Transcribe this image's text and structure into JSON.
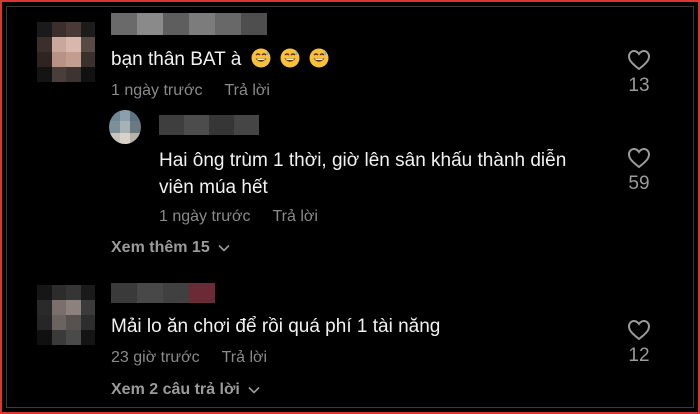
{
  "comments": [
    {
      "text": "bạn thân BAT à",
      "emoji": [
        "grinning-sweat-emoji",
        "grinning-sweat-emoji",
        "grinning-sweat-emoji"
      ],
      "time": "1 ngày trước",
      "reply": "Trả lời",
      "likes": "13"
    },
    {
      "text_line1": "Hai ông trùm 1 thời, giờ lên sân khấu thành diễn",
      "text_line2": "viên múa hết",
      "time": "1 ngày trước",
      "reply": "Trả lời",
      "likes": "59"
    },
    {
      "text": "Mải lo ăn chơi để rồi quá phí 1 tài năng",
      "time": "23 giờ trước",
      "reply": "Trả lời",
      "likes": "12"
    }
  ],
  "view_more_1": "Xem thêm 15",
  "view_more_2": "Xem 2 câu trả lời",
  "colors": {
    "background": "#000000",
    "text": "#f2f2f2",
    "muted": "#8a8a8a",
    "frame_border": "#d9372f"
  }
}
